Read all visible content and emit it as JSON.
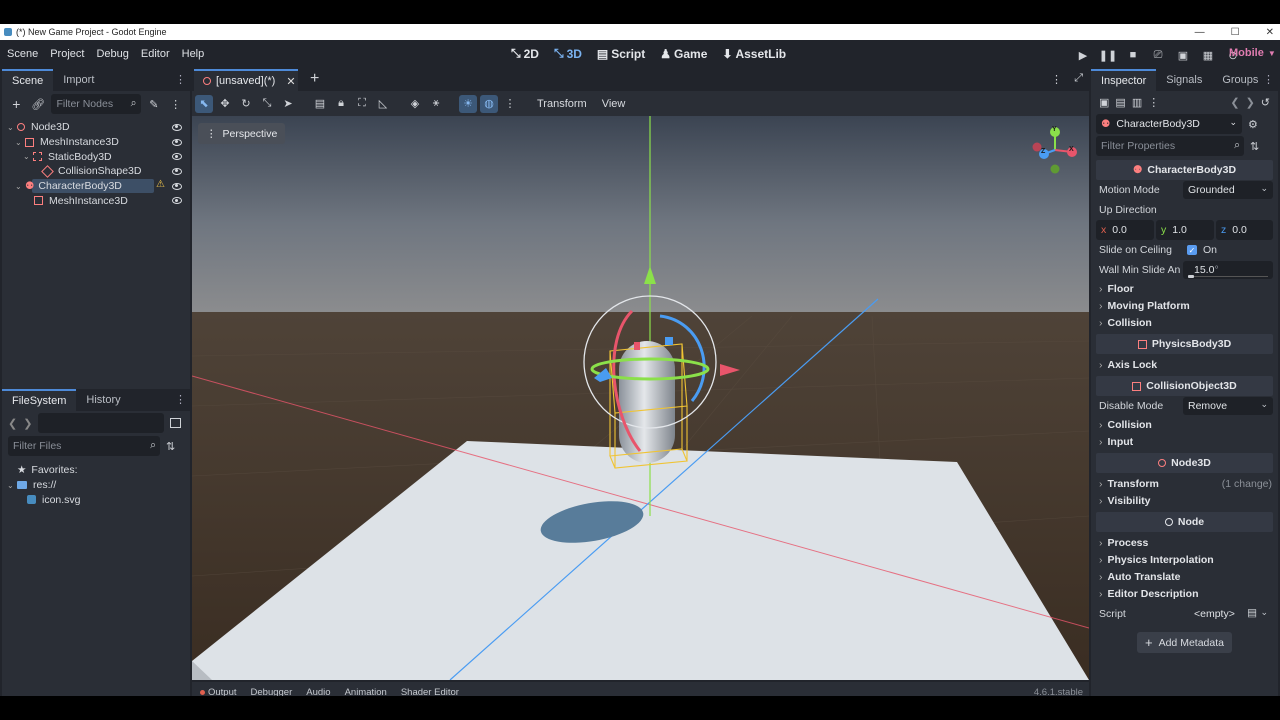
{
  "window": {
    "title": "(*) New Game Project - Godot Engine"
  },
  "menu": [
    "Scene",
    "Project",
    "Debug",
    "Editor",
    "Help"
  ],
  "workspaces": [
    {
      "label": "2D",
      "icon": "2d-icon"
    },
    {
      "label": "3D",
      "icon": "3d-icon",
      "active": true
    },
    {
      "label": "Script",
      "icon": "script-icon"
    },
    {
      "label": "Game",
      "icon": "game-icon"
    },
    {
      "label": "AssetLib",
      "icon": "assetlib-icon"
    }
  ],
  "renderer": "Mobile",
  "scene_dock": {
    "tabs": [
      "Scene",
      "Import"
    ],
    "filter_placeholder": "Filter Nodes",
    "tree": [
      {
        "name": "Node3D",
        "indent": 0,
        "icon_color": "#fc7f7f",
        "warning": false
      },
      {
        "name": "MeshInstance3D",
        "indent": 1,
        "icon_color": "#fc7f7f",
        "warning": false
      },
      {
        "name": "StaticBody3D",
        "indent": 1,
        "icon_color": "#fc7f7f",
        "warning": false
      },
      {
        "name": "CollisionShape3D",
        "indent": 2,
        "icon_color": "#fc7f7f",
        "warning": false
      },
      {
        "name": "CharacterBody3D",
        "indent": 1,
        "icon_color": "#fc7f7f",
        "warning": true,
        "selected": true
      },
      {
        "name": "MeshInstance3D",
        "indent": 2,
        "icon_color": "#fc7f7f",
        "warning": false
      }
    ]
  },
  "filesystem_dock": {
    "tabs": [
      "FileSystem",
      "History"
    ],
    "filter_placeholder": "Filter Files",
    "items": [
      {
        "name": "Favorites:",
        "icon": "star-icon"
      },
      {
        "name": "res://",
        "icon": "folder-icon"
      },
      {
        "name": "icon.svg",
        "icon": "image-icon"
      }
    ]
  },
  "viewport": {
    "scene_tab": "[unsaved](*)",
    "toolbar_menus": [
      "Transform",
      "View"
    ],
    "perspective_label": "Perspective",
    "gizmo_axes": [
      "Y",
      "X",
      "Z"
    ]
  },
  "bottom_tabs": [
    "Output",
    "Debugger",
    "Audio",
    "Animation",
    "Shader Editor"
  ],
  "version": "4.6.1.stable",
  "inspector": {
    "tabs": [
      "Inspector",
      "Signals",
      "Groups"
    ],
    "object": "CharacterBody3D",
    "filter_placeholder": "Filter Properties",
    "character_section": "CharacterBody3D",
    "motion_mode_label": "Motion Mode",
    "motion_mode": "Grounded",
    "up_direction_label": "Up Direction",
    "up_x_label": "x",
    "up_x": "0.0",
    "up_y_label": "y",
    "up_y": "1.0",
    "up_z_label": "z",
    "up_z": "0.0",
    "slide_ceiling_label": "Slide on Ceiling",
    "slide_ceiling_value": "On",
    "wall_min_label": "Wall Min Slide An",
    "wall_min_value": "15.0",
    "wall_min_unit": "°",
    "groups_a": [
      "Floor",
      "Moving Platform",
      "Collision"
    ],
    "physics_section": "PhysicsBody3D",
    "groups_b": [
      "Axis Lock"
    ],
    "collision_section": "CollisionObject3D",
    "disable_mode_label": "Disable Mode",
    "disable_mode": "Remove",
    "groups_c": [
      "Collision",
      "Input"
    ],
    "node3d_section": "Node3D",
    "transform_label": "Transform",
    "transform_changes": "(1 change)",
    "visibility_label": "Visibility",
    "node_section": "Node",
    "groups_d": [
      "Process",
      "Physics Interpolation",
      "Auto Translate",
      "Editor Description"
    ],
    "script_label": "Script",
    "script_value": "<empty>",
    "add_metadata": "Add Metadata"
  }
}
